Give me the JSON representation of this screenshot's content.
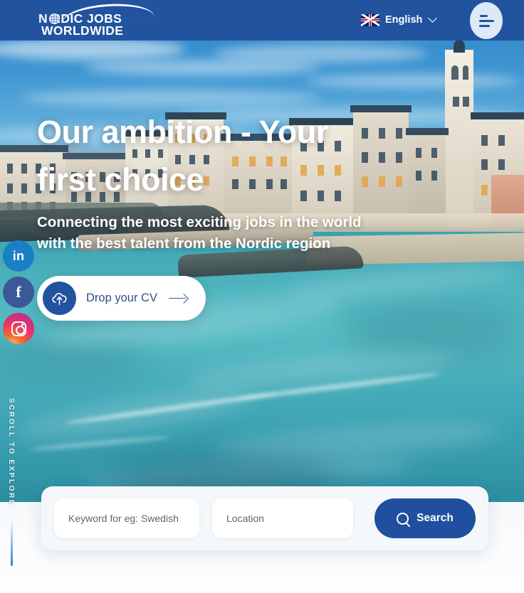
{
  "header": {
    "logo": {
      "line1": "N RDIC JOBS",
      "line2": "WORLDWIDE",
      "globe_icon": "globe-icon",
      "swoosh_icon": "swoosh-arc"
    },
    "language": {
      "label": "English",
      "flag_icon": "uk-flag-icon",
      "chevron_icon": "chevron-down-icon"
    },
    "menu": {
      "icon": "hamburger-menu-icon",
      "aria_label": "Menu"
    },
    "background_color": "#22539e"
  },
  "hero": {
    "headline": "Our ambition - Your first choice",
    "subhead_line1": "Connecting the most exciting jobs in the world",
    "subhead_line2": "with the best talent from the Nordic region",
    "cv_button": {
      "label": "Drop your CV",
      "upload_icon": "cloud-upload-icon",
      "arrow_icon": "arrow-right-icon",
      "circle_color": "#22539e"
    },
    "scroll_hint": "SCROLL TO EXPLORE"
  },
  "social": [
    {
      "name": "LinkedIn",
      "glyph": "in",
      "icon": "linkedin-icon",
      "color": "#1b7fc4"
    },
    {
      "name": "Facebook",
      "glyph": "f",
      "icon": "facebook-icon",
      "color": "#3b5998"
    },
    {
      "name": "Instagram",
      "glyph": "",
      "icon": "instagram-icon",
      "color": "#e8326d"
    }
  ],
  "search": {
    "keyword_placeholder": "Keyword for eg: Swedish",
    "keyword_value": "",
    "location_placeholder": "Location",
    "location_value": "",
    "button_label": "Search",
    "button_icon": "search-icon",
    "button_color": "#1f4f9e"
  }
}
